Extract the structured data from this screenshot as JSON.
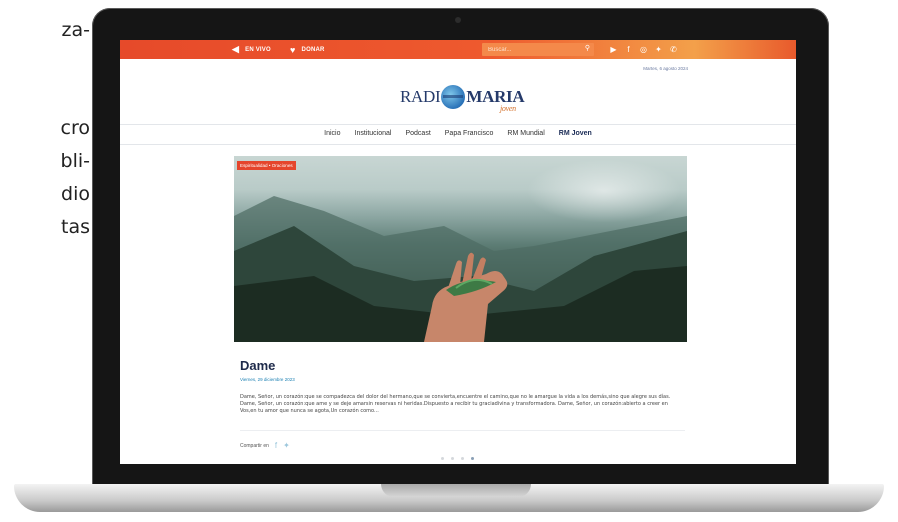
{
  "side_text": [
    "za-",
    "",
    "",
    "cro",
    "bli-",
    "dio",
    "tas"
  ],
  "topbar": {
    "live_label": "EN VIVO",
    "donate_label": "DONAR",
    "search_placeholder": "Buscar..."
  },
  "date": "Martes, 6 agosto 2024",
  "logo": {
    "part1": "RADI",
    "part2": "MARIA",
    "sub": "joven"
  },
  "nav": [
    {
      "label": "Inicio",
      "color": "#4a5a7a",
      "active": false
    },
    {
      "label": "Institucional",
      "color": "#e64a2a",
      "active": false
    },
    {
      "label": "Podcast",
      "color": "#4caf50",
      "active": false
    },
    {
      "label": "Papa Francisco",
      "color": "#f2b632",
      "active": false
    },
    {
      "label": "RM Mundial",
      "color": "#3fa7d6",
      "active": false
    },
    {
      "label": "RM Joven",
      "color": "#e64a2a",
      "active": true
    }
  ],
  "hero": {
    "tag": "Espiritualidad • Oraciones"
  },
  "article": {
    "title": "Dame",
    "date": "Viernes, 29 diciembre 2023",
    "body": "Dame, Señor, un corazón:que se compadezca del dolor del hermano,que se convierta,encuentre el camino,que no le amargue la vida a los demás,sino que alegre sus días. Dame, Señor, un corazón:que ame y se deje amarsin reservas ni heridas.Dispuesto a recibir tu graciadivina y transformadora. Dame, Señor, un corazón:abierto a creer en Vos,en tu amor que nunca se agota,Un corazón como...",
    "share_label": "Compartir en"
  },
  "carousel": {
    "active_index": 3,
    "count": 4
  },
  "colors": {
    "accent": "#e64a2a",
    "brand_blue": "#253a6a"
  }
}
